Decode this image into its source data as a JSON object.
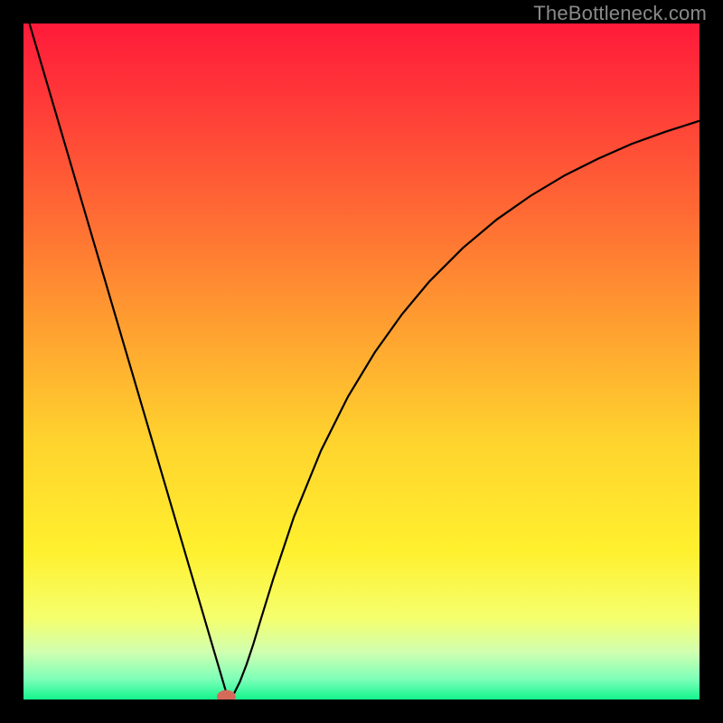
{
  "watermark": "TheBottleneck.com",
  "chart_data": {
    "type": "line",
    "title": "",
    "xlabel": "",
    "ylabel": "",
    "xlim": [
      0,
      100
    ],
    "ylim": [
      0,
      100
    ],
    "background_gradient": {
      "stops": [
        {
          "offset": 0,
          "color": "#ff1a3a"
        },
        {
          "offset": 12,
          "color": "#ff3b38"
        },
        {
          "offset": 28,
          "color": "#ff6a34"
        },
        {
          "offset": 45,
          "color": "#ffa030"
        },
        {
          "offset": 62,
          "color": "#ffd42e"
        },
        {
          "offset": 78,
          "color": "#fff02e"
        },
        {
          "offset": 88,
          "color": "#f5ff6e"
        },
        {
          "offset": 93,
          "color": "#d0ffb0"
        },
        {
          "offset": 97,
          "color": "#7dffb8"
        },
        {
          "offset": 100,
          "color": "#14f58e"
        }
      ]
    },
    "series": [
      {
        "name": "bottleneck-curve",
        "color": "#000000",
        "stroke_width": 2.2,
        "x": [
          0,
          2,
          4,
          6,
          8,
          10,
          12,
          14,
          16,
          18,
          20,
          22,
          24,
          25,
          26,
          27,
          27.5,
          28,
          28.5,
          29,
          29.5,
          30,
          30.5,
          31,
          32,
          33,
          34,
          35,
          37,
          40,
          44,
          48,
          52,
          56,
          60,
          65,
          70,
          75,
          80,
          85,
          90,
          95,
          100
        ],
        "y": [
          103,
          96.2,
          89.4,
          82.6,
          75.8,
          69.0,
          62.2,
          55.4,
          48.6,
          41.8,
          35.0,
          28.2,
          21.4,
          18.0,
          14.6,
          11.2,
          9.5,
          7.8,
          6.1,
          4.4,
          2.7,
          1.0,
          0.2,
          0.6,
          2.6,
          5.2,
          8.2,
          11.5,
          18.0,
          27.0,
          36.8,
          44.8,
          51.4,
          57.0,
          61.8,
          66.8,
          71.0,
          74.5,
          77.5,
          80.0,
          82.2,
          84.0,
          85.6
        ]
      }
    ],
    "marker": {
      "name": "target-marker",
      "x": 30.0,
      "y": 0.4,
      "color": "#d66a5a",
      "rx": 1.4,
      "ry": 1.0
    }
  }
}
